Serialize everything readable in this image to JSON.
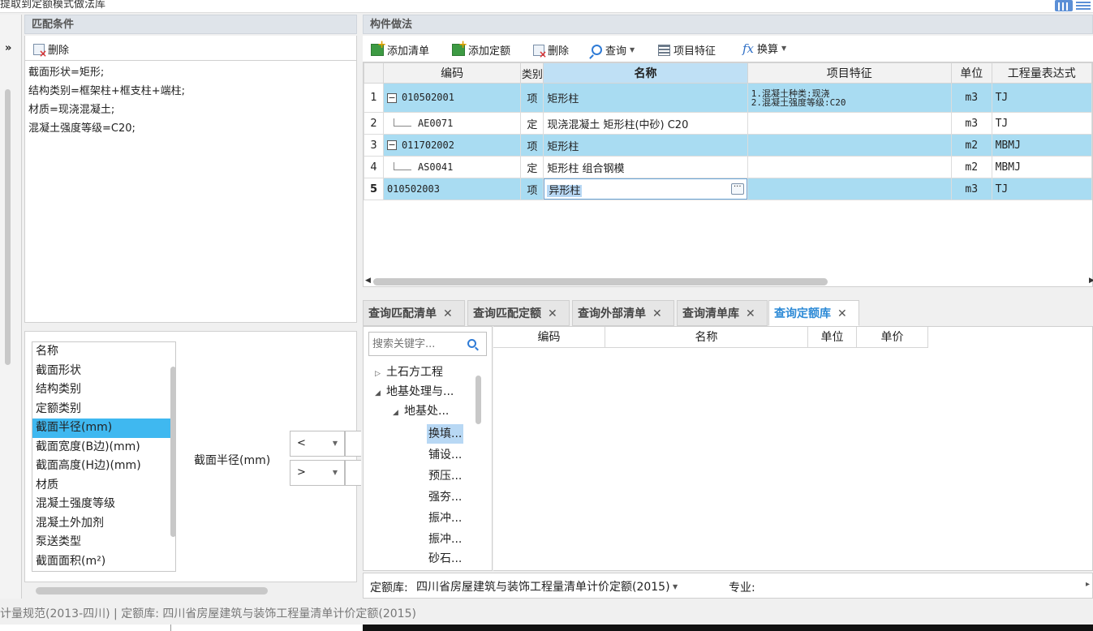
{
  "window": {
    "title": "提取到定额模式做法库"
  },
  "match": {
    "header": "匹配条件",
    "delete_label": "删除",
    "conditions": [
      "截面形状=矩形;",
      "结构类别=框架柱+框支柱+端柱;",
      "材质=现浇混凝土;",
      "混凝土强度等级=C20;"
    ]
  },
  "attributes": {
    "items": [
      "名称",
      "截面形状",
      "结构类别",
      "定额类别",
      "截面半径(mm)",
      "截面宽度(B边)(mm)",
      "截面高度(H边)(mm)",
      "材质",
      "混凝土强度等级",
      "混凝土外加剂",
      "泵送类型",
      "截面面积(m²)"
    ],
    "selected": "截面半径(mm)",
    "condition_label": "截面半径(mm)",
    "op1": "<",
    "op2": ">"
  },
  "method": {
    "header": "构件做法",
    "toolbar": {
      "add_list": "添加清单",
      "add_quota": "添加定额",
      "delete": "删除",
      "query": "查询",
      "features": "项目特征",
      "convert": "换算"
    },
    "columns": [
      "编码",
      "类别",
      "名称",
      "项目特征",
      "单位",
      "工程量表达式"
    ],
    "rows": [
      {
        "num": "1",
        "code": "010502001",
        "type": "项",
        "name": "矩形柱",
        "feature1": "1.混凝土种类:现浇",
        "feature2": "2.混凝土强度等级:C20",
        "unit": "m3",
        "expr": "TJ"
      },
      {
        "num": "2",
        "code": "AE0071",
        "type": "定",
        "name": "现浇混凝土 矩形柱(中砂) C20",
        "feature1": "",
        "feature2": "",
        "unit": "m3",
        "expr": "TJ"
      },
      {
        "num": "3",
        "code": "011702002",
        "type": "项",
        "name": "矩形柱",
        "feature1": "",
        "feature2": "",
        "unit": "m2",
        "expr": "MBMJ"
      },
      {
        "num": "4",
        "code": "AS0041",
        "type": "定",
        "name": "矩形柱 组合钢模",
        "feature1": "",
        "feature2": "",
        "unit": "m2",
        "expr": "MBMJ"
      },
      {
        "num": "5",
        "code": "010502003",
        "type": "项",
        "name": "异形柱",
        "feature1": "",
        "feature2": "",
        "unit": "m3",
        "expr": "TJ"
      }
    ],
    "edit_button": "···"
  },
  "tabs": [
    {
      "label": "查询匹配清单",
      "close": "✕"
    },
    {
      "label": "查询匹配定额",
      "close": "✕"
    },
    {
      "label": "查询外部清单",
      "close": "✕"
    },
    {
      "label": "查询清单库",
      "close": "✕"
    },
    {
      "label": "查询定额库",
      "close": "✕"
    }
  ],
  "search": {
    "placeholder": "搜索关键字..."
  },
  "tree": [
    "土石方工程",
    "地基处理与...",
    "地基处...",
    "换填...",
    "铺设...",
    "预压...",
    "强夯...",
    "振冲...",
    "振冲...",
    "砂石..."
  ],
  "results": {
    "columns": [
      "编码",
      "名称",
      "单位",
      "单价"
    ]
  },
  "quota": {
    "label": "定额库:",
    "value": "四川省房屋建筑与装饰工程量清单计价定额(2015)",
    "spec_label": "专业:"
  },
  "status": {
    "text": "计量规范(2013-四川)  |  定额库: 四川省房屋建筑与装饰工程量清单计价定额(2015)"
  },
  "colors": {
    "accent": "#2d8ad6",
    "row_highlight": "#a9dcf2",
    "selection": "#3fb8f0"
  }
}
